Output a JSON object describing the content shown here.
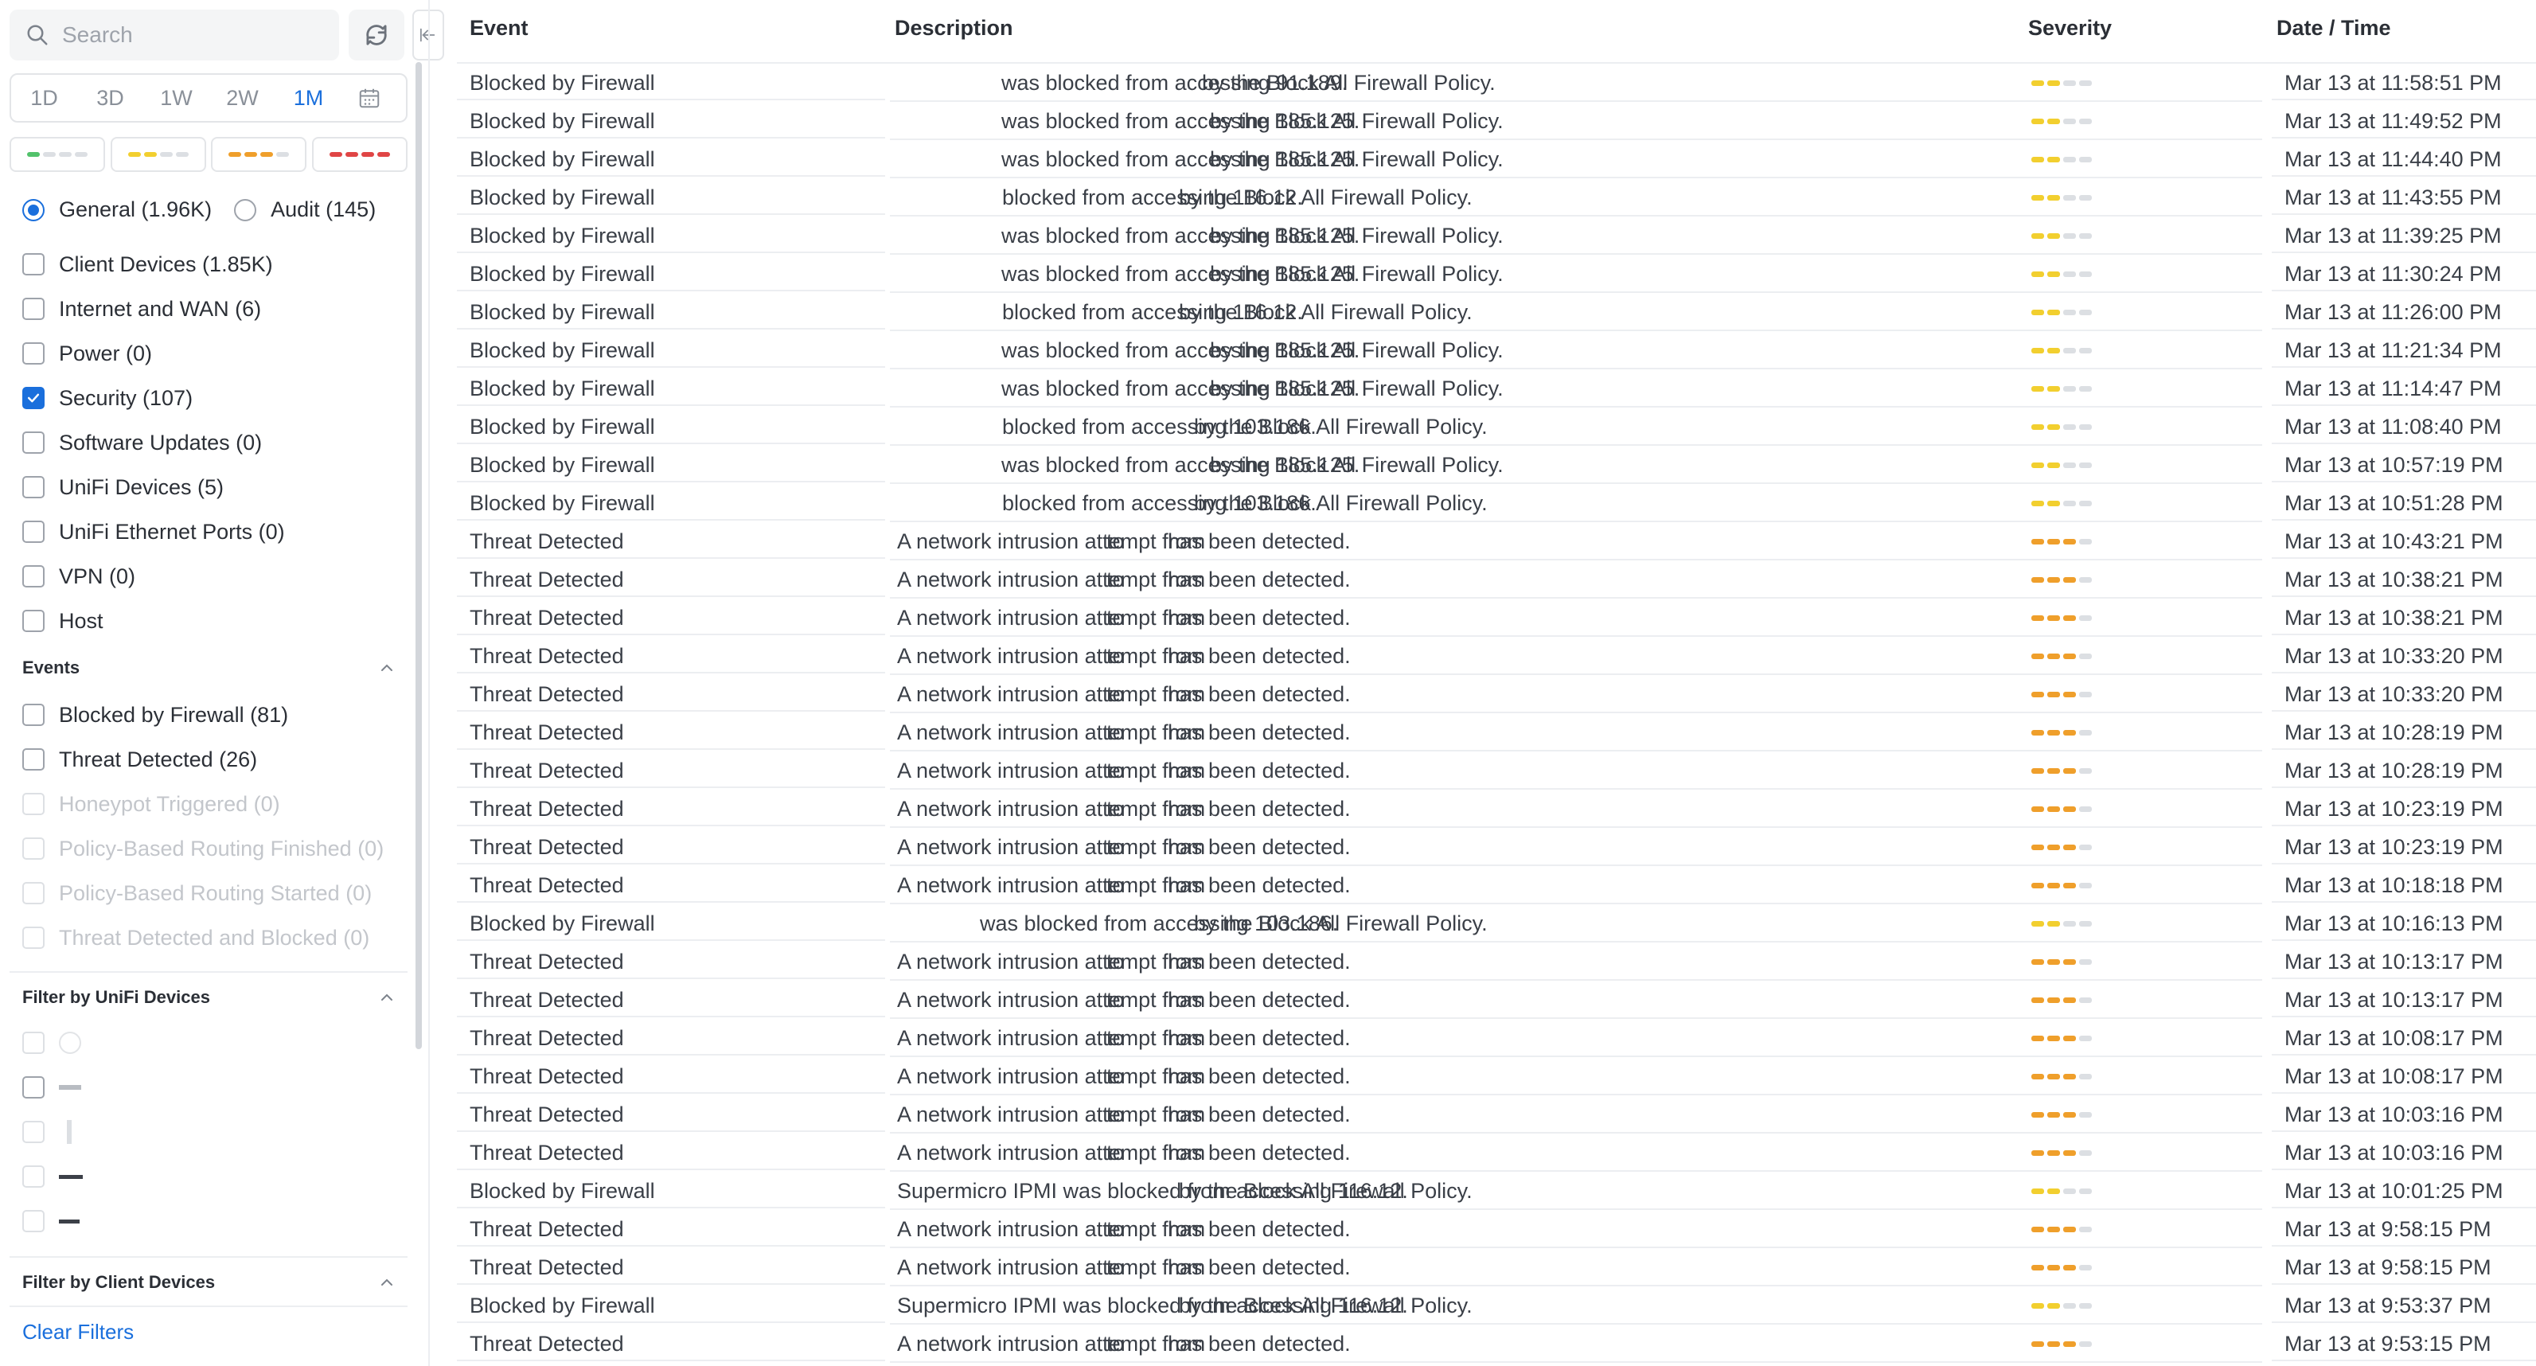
{
  "sidebar": {
    "search_placeholder": "Search",
    "time_ranges": [
      "1D",
      "3D",
      "1W",
      "2W",
      "1M"
    ],
    "active_range": "1M",
    "severity_colors": {
      "low": "#52c26b",
      "medium": "#f2cf2f",
      "high": "#ef9f2b",
      "critical": "#e04545",
      "empty": "#dcdfe3"
    },
    "log_types": [
      {
        "label": "General (1.96K)",
        "checked": true
      },
      {
        "label": "Audit (145)",
        "checked": false
      }
    ],
    "categories": [
      {
        "label": "Client Devices (1.85K)",
        "checked": false
      },
      {
        "label": "Internet and WAN (6)",
        "checked": false
      },
      {
        "label": "Power (0)",
        "checked": false
      },
      {
        "label": "Security (107)",
        "checked": true
      },
      {
        "label": "Software Updates (0)",
        "checked": false
      },
      {
        "label": "UniFi Devices (5)",
        "checked": false
      },
      {
        "label": "UniFi Ethernet Ports (0)",
        "checked": false
      },
      {
        "label": "VPN (0)",
        "checked": false
      },
      {
        "label": "Host",
        "checked": false
      }
    ],
    "events_heading": "Events",
    "events": [
      {
        "label": "Blocked by Firewall (81)",
        "enabled": true
      },
      {
        "label": "Threat Detected (26)",
        "enabled": true
      },
      {
        "label": "Honeypot Triggered (0)",
        "enabled": false
      },
      {
        "label": "Policy-Based Routing Finished (0)",
        "enabled": false
      },
      {
        "label": "Policy-Based Routing Started (0)",
        "enabled": false
      },
      {
        "label": "Threat Detected and Blocked (0)",
        "enabled": false
      }
    ],
    "unifi_devices_heading": "Filter by UniFi Devices",
    "client_devices_heading": "Filter by Client Devices",
    "clear_filters": "Clear Filters"
  },
  "table": {
    "headers": {
      "event": "Event",
      "description": "Description",
      "severity": "Severity",
      "datetime": "Date / Time"
    },
    "rows": [
      {
        "event": "Blocked by Firewall",
        "d1": "was blocked from accessing 91.189.",
        "d2": "by the Block All Firewall Policy.",
        "sev": 2,
        "date": "Mar 13 at 11:58:51 PM"
      },
      {
        "event": "Blocked by Firewall",
        "d1": "was blocked from accessing 185.125.",
        "d2": "by the Block All Firewall Policy.",
        "sev": 2,
        "date": "Mar 13 at 11:49:52 PM"
      },
      {
        "event": "Blocked by Firewall",
        "d1": "was blocked from accessing 185.125.",
        "d2": "by the Block All Firewall Policy.",
        "sev": 2,
        "date": "Mar 13 at 11:44:40 PM"
      },
      {
        "event": "Blocked by Firewall",
        "d1": "blocked from accessing 116.12.",
        "d2": "by the Block All Firewall Policy.",
        "sev": 2,
        "date": "Mar 13 at 11:43:55 PM"
      },
      {
        "event": "Blocked by Firewall",
        "d1": "was blocked from accessing 185.125.",
        "d2": "by the Block All Firewall Policy.",
        "sev": 2,
        "date": "Mar 13 at 11:39:25 PM"
      },
      {
        "event": "Blocked by Firewall",
        "d1": "was blocked from accessing 185.125.",
        "d2": "by the Block All Firewall Policy.",
        "sev": 2,
        "date": "Mar 13 at 11:30:24 PM"
      },
      {
        "event": "Blocked by Firewall",
        "d1": "blocked from accessing 116.12.",
        "d2": "by the Block All Firewall Policy.",
        "sev": 2,
        "date": "Mar 13 at 11:26:00 PM"
      },
      {
        "event": "Blocked by Firewall",
        "d1": "was blocked from accessing 185.125.",
        "d2": "by the Block All Firewall Policy.",
        "sev": 2,
        "date": "Mar 13 at 11:21:34 PM"
      },
      {
        "event": "Blocked by Firewall",
        "d1": "was blocked from accessing 185.125.",
        "d2": "by the Block All Firewall Policy.",
        "sev": 2,
        "date": "Mar 13 at 11:14:47 PM"
      },
      {
        "event": "Blocked by Firewall",
        "d1": "blocked from accessing 103.186.",
        "d2": "by the Block All Firewall Policy.",
        "sev": 2,
        "date": "Mar 13 at 11:08:40 PM"
      },
      {
        "event": "Blocked by Firewall",
        "d1": "was blocked from accessing 185.125.",
        "d2": "by the Block All Firewall Policy.",
        "sev": 2,
        "date": "Mar 13 at 10:57:19 PM"
      },
      {
        "event": "Blocked by Firewall",
        "d1": "blocked from accessing 103.186.",
        "d2": "by the Block All Firewall Policy.",
        "sev": 2,
        "date": "Mar 13 at 10:51:28 PM"
      },
      {
        "event": "Threat Detected",
        "d1": "A network intrusion attempt from",
        "d2": "to",
        "d3": "has been detected.",
        "sev": 3,
        "date": "Mar 13 at 10:43:21 PM"
      },
      {
        "event": "Threat Detected",
        "d1": "A network intrusion attempt from",
        "d2": "to",
        "d3": "has been detected.",
        "sev": 3,
        "date": "Mar 13 at 10:38:21 PM"
      },
      {
        "event": "Threat Detected",
        "d1": "A network intrusion attempt from",
        "d2": "to",
        "d3": "has been detected.",
        "sev": 3,
        "date": "Mar 13 at 10:38:21 PM"
      },
      {
        "event": "Threat Detected",
        "d1": "A network intrusion attempt from",
        "d2": "to",
        "d3": "has been detected.",
        "sev": 3,
        "date": "Mar 13 at 10:33:20 PM"
      },
      {
        "event": "Threat Detected",
        "d1": "A network intrusion attempt from",
        "d2": "to",
        "d3": "has been detected.",
        "sev": 3,
        "date": "Mar 13 at 10:33:20 PM"
      },
      {
        "event": "Threat Detected",
        "d1": "A network intrusion attempt from",
        "d2": "to",
        "d3": "has been detected.",
        "sev": 3,
        "date": "Mar 13 at 10:28:19 PM"
      },
      {
        "event": "Threat Detected",
        "d1": "A network intrusion attempt from",
        "d2": "to",
        "d3": "has been detected.",
        "sev": 3,
        "date": "Mar 13 at 10:28:19 PM"
      },
      {
        "event": "Threat Detected",
        "d1": "A network intrusion attempt from",
        "d2": "to",
        "d3": "has been detected.",
        "sev": 3,
        "date": "Mar 13 at 10:23:19 PM"
      },
      {
        "event": "Threat Detected",
        "d1": "A network intrusion attempt from",
        "d2": "to",
        "d3": "has been detected.",
        "sev": 3,
        "date": "Mar 13 at 10:23:19 PM"
      },
      {
        "event": "Threat Detected",
        "d1": "A network intrusion attempt from",
        "d2": "to",
        "d3": "has been detected.",
        "sev": 3,
        "date": "Mar 13 at 10:18:18 PM"
      },
      {
        "event": "Blocked by Firewall",
        "d1": "was blocked from accessing 103.186.",
        "d2": "by the Block All Firewall Policy.",
        "sev": 2,
        "date": "Mar 13 at 10:16:13 PM"
      },
      {
        "event": "Threat Detected",
        "d1": "A network intrusion attempt from",
        "d2": "to",
        "d3": "has been detected.",
        "sev": 3,
        "date": "Mar 13 at 10:13:17 PM"
      },
      {
        "event": "Threat Detected",
        "d1": "A network intrusion attempt from",
        "d2": "to",
        "d3": "has been detected.",
        "sev": 3,
        "date": "Mar 13 at 10:13:17 PM"
      },
      {
        "event": "Threat Detected",
        "d1": "A network intrusion attempt from",
        "d2": "to",
        "d3": "has been detected.",
        "sev": 3,
        "date": "Mar 13 at 10:08:17 PM"
      },
      {
        "event": "Threat Detected",
        "d1": "A network intrusion attempt from",
        "d2": "to",
        "d3": "has been detected.",
        "sev": 3,
        "date": "Mar 13 at 10:08:17 PM"
      },
      {
        "event": "Threat Detected",
        "d1": "A network intrusion attempt from",
        "d2": "to",
        "d3": "has been detected.",
        "sev": 3,
        "date": "Mar 13 at 10:03:16 PM"
      },
      {
        "event": "Threat Detected",
        "d1": "A network intrusion attempt from",
        "d2": "to",
        "d3": "has been detected.",
        "sev": 3,
        "date": "Mar 13 at 10:03:16 PM"
      },
      {
        "event": "Blocked by Firewall",
        "d1": "Supermicro IPMI was blocked from accessing 116.12.",
        "d2": "by the Block All Firewall Policy.",
        "sev": 2,
        "date": "Mar 13 at 10:01:25 PM"
      },
      {
        "event": "Threat Detected",
        "d1": "A network intrusion attempt from",
        "d2": "to",
        "d3": "has been detected.",
        "sev": 3,
        "date": "Mar 13 at 9:58:15 PM"
      },
      {
        "event": "Threat Detected",
        "d1": "A network intrusion attempt from",
        "d2": "to",
        "d3": "has been detected.",
        "sev": 3,
        "date": "Mar 13 at 9:58:15 PM"
      },
      {
        "event": "Blocked by Firewall",
        "d1": "Supermicro IPMI was blocked from accessing 116.12.",
        "d2": "by the Block All Firewall Policy.",
        "sev": 2,
        "date": "Mar 13 at 9:53:37 PM"
      },
      {
        "event": "Threat Detected",
        "d1": "A network intrusion attempt from",
        "d2": "to",
        "d3": "has been detected.",
        "sev": 3,
        "date": "Mar 13 at 9:53:15 PM"
      }
    ]
  }
}
